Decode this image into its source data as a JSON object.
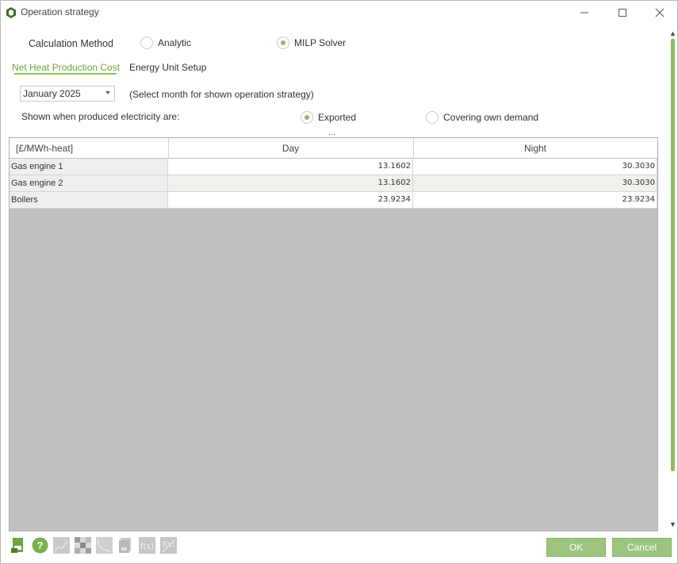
{
  "window": {
    "title": "Operation strategy"
  },
  "calc_method": {
    "label": "Calculation Method",
    "options": [
      {
        "label": "Analytic",
        "selected": false
      },
      {
        "label": "MILP Solver",
        "selected": true
      }
    ]
  },
  "tabs": [
    {
      "label": "Net Heat Production Cost",
      "active": true
    },
    {
      "label": "Energy Unit Setup",
      "active": false
    }
  ],
  "month": {
    "selected": "January 2025",
    "hint": "(Select month for shown operation strategy)"
  },
  "electricity": {
    "label": "Shown when produced electricity are:",
    "options": [
      {
        "label": "Exported",
        "selected": true
      },
      {
        "label": "Covering own demand",
        "selected": false
      }
    ],
    "ellipsis": "..."
  },
  "table": {
    "headers": [
      "[£/MWh-heat]",
      "Day",
      "Night"
    ],
    "rows": [
      {
        "name": "Gas engine 1",
        "day": "13.1602",
        "night": "30.3030"
      },
      {
        "name": "Gas engine 2",
        "day": "13.1602",
        "night": "30.3030"
      },
      {
        "name": "Boilers",
        "day": "23.9234",
        "night": "23.9234"
      }
    ]
  },
  "toolbar_icons": [
    "export-icon",
    "help-icon",
    "chart-icon",
    "heatmap-icon",
    "curve-icon",
    "document-icon",
    "function-icon",
    "function-delete-icon"
  ],
  "buttons": {
    "ok": "OK",
    "cancel": "Cancel"
  },
  "colors": {
    "accent": "#8bbf5e",
    "button": "#9cc47c",
    "grid_bg": "#c0c0c0"
  }
}
